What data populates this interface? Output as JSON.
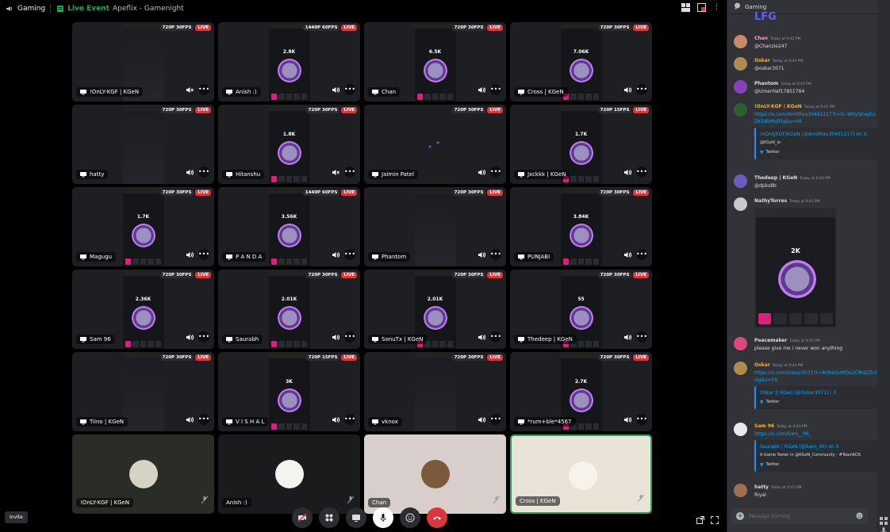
{
  "topbar": {
    "server": "Gaming",
    "event_label": "Live Event",
    "event_name": "Apeflix - Gamenight"
  },
  "tiles": [
    {
      "name": "!OnLY-KGF | KGeN",
      "quality": "720P 30FPS",
      "live": "LIVE",
      "coin": "",
      "muted": true
    },
    {
      "name": "Anish :)",
      "quality": "1440P 60FPS",
      "live": "LIVE",
      "coin": "2.8K"
    },
    {
      "name": "Chan",
      "quality": "720P 30FPS",
      "live": "LIVE",
      "coin": "6.5K"
    },
    {
      "name": "Cross | KGeN",
      "quality": "720P 30FPS",
      "live": "LIVE",
      "coin": "7.06K"
    },
    {
      "name": "hatty",
      "quality": "720P 30FPS",
      "live": "LIVE",
      "coin": ""
    },
    {
      "name": "Hitanshu",
      "quality": "720P 30FPS",
      "live": "LIVE",
      "coin": "1.8K",
      "muted": true
    },
    {
      "name": "Jaimin Patel",
      "quality": "720P 30FPS",
      "live": "LIVE",
      "coin": ""
    },
    {
      "name": "Jxckkk | KGeN",
      "quality": "720P 15FPS",
      "live": "LIVE",
      "coin": "1.7K"
    },
    {
      "name": "Magugu",
      "quality": "720P 30FPS",
      "live": "LIVE",
      "coin": "1.7K"
    },
    {
      "name": "P A N D A",
      "quality": "1440P 60FPS",
      "live": "LIVE",
      "coin": "3.56K"
    },
    {
      "name": "Phantom",
      "quality": "720P 30FPS",
      "live": "LIVE",
      "coin": ""
    },
    {
      "name": "PUNJABI",
      "quality": "720P 30FPS",
      "live": "LIVE",
      "coin": "3.84K"
    },
    {
      "name": "Sam 96",
      "quality": "720P 30FPS",
      "live": "LIVE",
      "coin": "2.36K"
    },
    {
      "name": "Saurabh",
      "quality": "720P 30FPS",
      "live": "LIVE",
      "coin": "2.01K"
    },
    {
      "name": "SonuTx | KGeN",
      "quality": "720P 30FPS",
      "live": "LIVE",
      "coin": "2.01K"
    },
    {
      "name": "Thedeep | KGeN",
      "quality": "720P 30FPS",
      "live": "LIVE",
      "coin": "55"
    },
    {
      "name": "Tiino | KGeN",
      "quality": "720P 30FPS",
      "live": "LIVE",
      "coin": ""
    },
    {
      "name": "V I S H A L",
      "quality": "720P 15FPS",
      "live": "LIVE",
      "coin": "3K"
    },
    {
      "name": "vknox",
      "quality": "720P 30FPS",
      "live": "LIVE",
      "coin": ""
    },
    {
      "name": "*rum+ble*4567",
      "quality": "720P 30FPS",
      "live": "LIVE",
      "coin": "2.7K"
    }
  ],
  "cams": [
    {
      "name": "!OnLY-KGF | KGeN"
    },
    {
      "name": "Anish :)"
    },
    {
      "name": "Chan"
    },
    {
      "name": "Cross | KGeN"
    }
  ],
  "invite_label": "Invite",
  "chat": {
    "channel": "Gaming",
    "header_snippet": "LFG",
    "messages": [
      {
        "name": "Chan",
        "color": "#f2a3d0",
        "time": "Today at 9:42 PM",
        "text": "@Chanzie247"
      },
      {
        "name": "Oskar",
        "color": "#f0b232",
        "time": "Today at 9:43 PM",
        "text": "@oskar3071"
      },
      {
        "name": "Phantom",
        "color": "#dbdee1",
        "time": "Today at 9:43 PM",
        "text": "@UmerHaf17851764"
      },
      {
        "name": "!OnLY-KGF | KGeN",
        "color": "#f0b232",
        "time": "Today at 9:43 PM",
        "link": "https://x.com/AmitRau30491217?t=G--W5yQnejXuDKS8kMufOg&s=09",
        "embed_title": "!nOnlyKGF|KGeN (@AmitRau30491217) on X",
        "embed_sub": "@KGeN_io",
        "embed_src": "Twitter"
      },
      {
        "name": "Thedeep | KGeN",
        "color": "#dbdee1",
        "time": "Today at 9:43 PM",
        "text": "@dpks8b"
      },
      {
        "name": "NathyTorres",
        "color": "#dbdee1",
        "time": "Today at 9:43 PM",
        "img_coin": "2K"
      },
      {
        "name": "Peacemaker",
        "color": "#dbdee1",
        "time": "Today at 9:43 PM",
        "text": "please give me i never won anything"
      },
      {
        "name": "Oskar",
        "color": "#f0b232",
        "time": "Today at 9:43 PM",
        "link": "https://x.com/Oskar3071?t=AV8eGuRf0u2CfKd2ZzYsIg&s=09",
        "embed_title": "Oskar || KGen (@Oskar3071) / X",
        "embed_src": "Twitter"
      },
      {
        "name": "Sam 96",
        "color": "#f0b232",
        "time": "Today at 9:43 PM",
        "link": "https://x.com/Sam__96_",
        "embed_title": "Saurabh | KGeN (@Sam_96) on X",
        "embed_sub": "A Game Tester in @KGeN_Community - #TeamKOS",
        "embed_src": "Twitter"
      },
      {
        "name": "hatty",
        "color": "#dbdee1",
        "time": "Today at 9:43 PM",
        "text": "Riyal"
      }
    ],
    "input_placeholder": "Message Gaming"
  }
}
